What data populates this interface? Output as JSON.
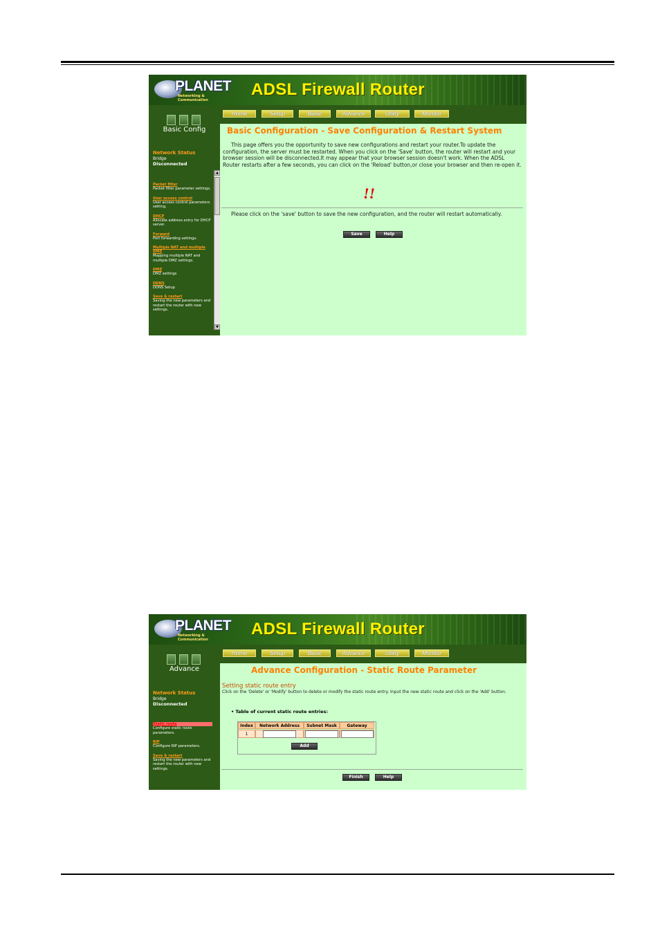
{
  "brand": {
    "logo": "PLANET",
    "tagline": "Networking & Communication",
    "product": "ADSL  Firewall Router"
  },
  "nav": [
    "Home",
    "Setup",
    "Basic",
    "Advance",
    "Utility",
    "Monitor"
  ],
  "screen1": {
    "section_title": "Basic Config",
    "status": {
      "heading": "Network Status",
      "mode": "Bridge",
      "state": "Disconnected"
    },
    "menu": [
      {
        "link": "Packet filter",
        "desc": "Packet filter parameter settings."
      },
      {
        "link": "User access control",
        "desc": "User access control parameters setting."
      },
      {
        "link": "DHCP",
        "desc": "Allocate address entry for DHCP server."
      },
      {
        "link": "Forward",
        "desc": "Port forwarding settings."
      },
      {
        "link": "Multiple NAT and multiple DMZ",
        "desc": "Mapping multiple NAT and multiple DMZ settings."
      },
      {
        "link": "DMZ",
        "desc": "DMZ settings"
      },
      {
        "link": "DDNS",
        "desc": "DDNS Setup"
      },
      {
        "link": "Save & restart",
        "desc": "Saving the new parameters and restart the router with new settings."
      }
    ],
    "title": "Basic Configuration - Save Configuration & Restart System",
    "intro": "This page offers you the opportunity to save new configurations and restart your router.To update the configuration, the server must be restarted. When you click on the 'Save' button, the router will restart and your browser session will be disconnected.It may appear that your browser session doesn't work. When the ADSL Router restarts after a few seconds, you can click on the 'Reload' button,or close your browser and then re-open it.",
    "warning": "!!",
    "instruction": "Please click on the 'save' button to save the new configuration, and the router will restart automatically.",
    "buttons": {
      "save": "Save",
      "help": "Help"
    }
  },
  "screen2": {
    "section_title": "Advance",
    "status": {
      "heading": "Network Status",
      "mode": "Bridge",
      "state": "Disconnected"
    },
    "menu": [
      {
        "link": "Static route",
        "desc": "Configure static route parameters."
      },
      {
        "link": "RIP",
        "desc": "Configure RIP parameters."
      },
      {
        "link": "Save & restart",
        "desc": "Saving the new parameters and restart the router with new settings."
      }
    ],
    "title": "Advance Configuration - Static Route Parameter",
    "subtitle": "Setting static route entry",
    "intro": "Click on the 'Delete' or 'Modify' button to delete or modify the static route entry. Input the new static route and click on the 'Add' button.",
    "table_caption": "Table of current static route entries:",
    "columns": [
      "Index",
      "Network Address",
      "Subnet Mask",
      "Gateway"
    ],
    "row_index": "1",
    "buttons": {
      "add": "Add",
      "finish": "Finish",
      "help": "Help"
    }
  },
  "colors": {
    "accent": "#ff8000",
    "panel": "#ccffcc",
    "sidebar": "#2d5a16",
    "nav": "#d6cc33"
  }
}
